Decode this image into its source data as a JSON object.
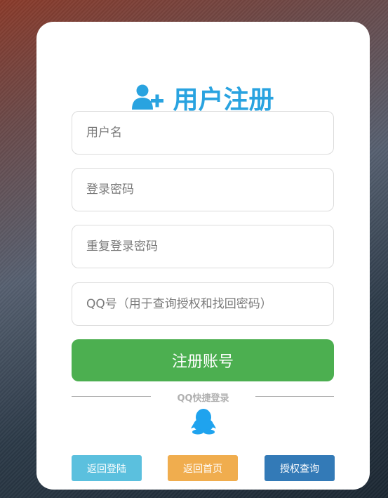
{
  "header": {
    "title": "用户注册",
    "icon": "user-plus-icon",
    "color": "#29a3e0"
  },
  "form": {
    "username_placeholder": "用户名",
    "password_placeholder": "登录密码",
    "repeat_password_placeholder": "重复登录密码",
    "qq_placeholder": "QQ号（用于查询授权和找回密码）",
    "submit_label": "注册账号",
    "submit_color": "#4caf50"
  },
  "quick_login": {
    "label": "QQ快捷登录",
    "icon": "qq-penguin-icon",
    "color": "#1fa3ee"
  },
  "footer": {
    "buttons": [
      {
        "label": "返回登陆",
        "color": "#5bc0de"
      },
      {
        "label": "返回首页",
        "color": "#f0ad4e"
      },
      {
        "label": "授权查询",
        "color": "#337ab7"
      }
    ]
  }
}
